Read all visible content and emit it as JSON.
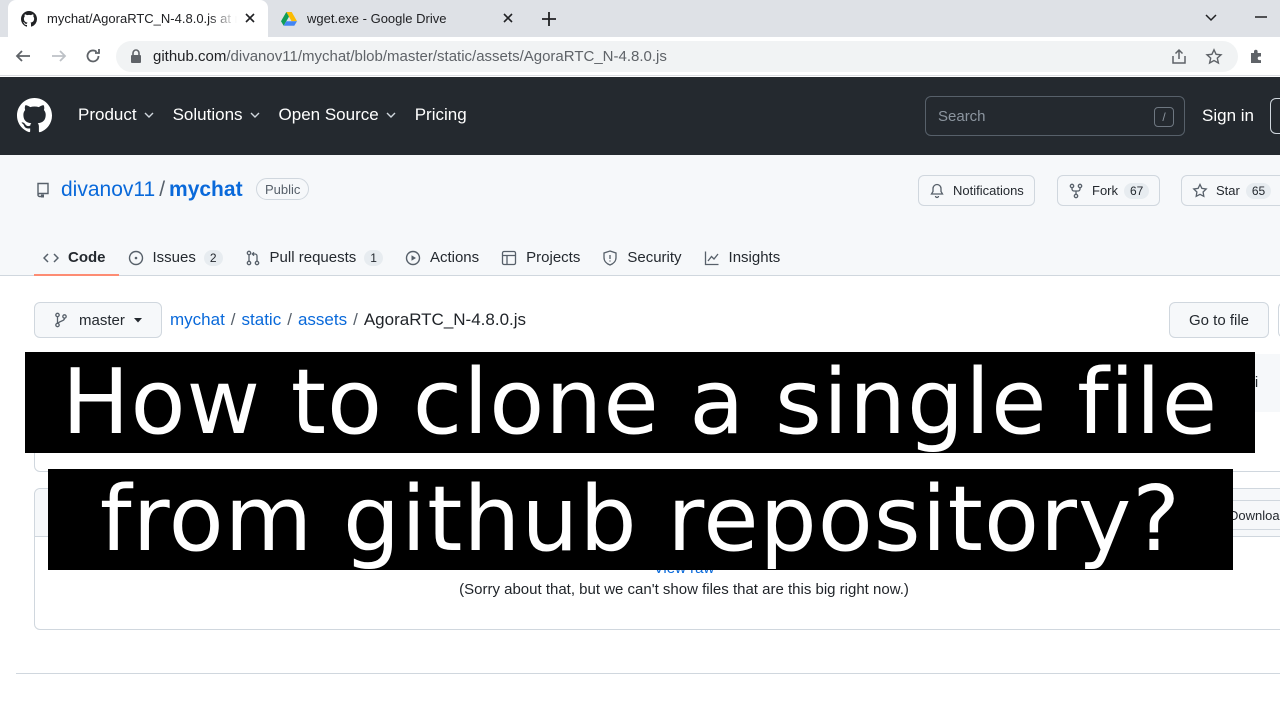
{
  "browser": {
    "tabs": [
      {
        "title": "mychat/AgoraRTC_N-4.8.0.js at m",
        "favicon": "github-icon",
        "active": true
      },
      {
        "title": "wget.exe - Google Drive",
        "favicon": "google-drive-icon",
        "active": false
      }
    ],
    "url": {
      "host": "github.com",
      "path": "/divanov11/mychat/blob/master/static/assets/AgoraRTC_N-4.8.0.js"
    }
  },
  "github": {
    "nav": [
      "Product",
      "Solutions",
      "Open Source",
      "Pricing"
    ],
    "search_placeholder": "Search",
    "search_key": "/",
    "sign_in": "Sign in"
  },
  "repo": {
    "owner": "divanov11",
    "separator": "/",
    "name": "mychat",
    "visibility": "Public",
    "notifications_label": "Notifications",
    "fork_label": "Fork",
    "fork_count": "67",
    "star_label": "Star",
    "star_count": "65",
    "tabs": [
      {
        "label": "Code",
        "count": ""
      },
      {
        "label": "Issues",
        "count": "2"
      },
      {
        "label": "Pull requests",
        "count": "1"
      },
      {
        "label": "Actions",
        "count": ""
      },
      {
        "label": "Projects",
        "count": ""
      },
      {
        "label": "Security",
        "count": ""
      },
      {
        "label": "Insights",
        "count": ""
      }
    ]
  },
  "file": {
    "branch": "master",
    "breadcrumb": [
      "mychat",
      "static",
      "assets"
    ],
    "filename": "AgoraRTC_N-4.8.0.js",
    "go_to_file": "Go to file",
    "history_label": "Hi",
    "download_label": "Download",
    "view_raw": "View raw",
    "too_big_message": "(Sorry about that, but we can't show files that are this big right now.)"
  },
  "overlay": {
    "line1": "How to clone a single file",
    "line2": "from github repository?"
  },
  "colors": {
    "header_bg": "#24292f",
    "link": "#0969da",
    "tab_underline": "#fd8c73"
  }
}
